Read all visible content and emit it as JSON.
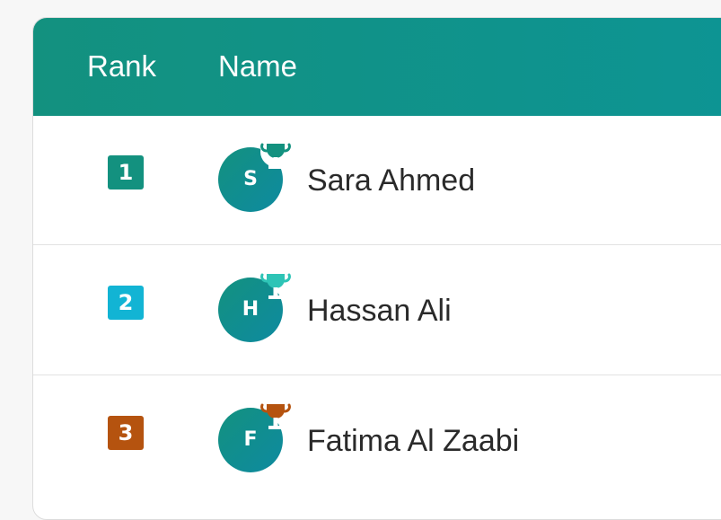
{
  "header": {
    "rank_label": "Rank",
    "name_label": "Name",
    "background": "#13917f"
  },
  "rows": [
    {
      "rank": "1",
      "rank_color": "#13917f",
      "initial": "S",
      "name": "Sara Ahmed",
      "trophy_icon": "trophy-icon",
      "trophy_color": "#ffffff"
    },
    {
      "rank": "2",
      "rank_color": "#12b4d4",
      "initial": "H",
      "name": "Hassan Ali",
      "trophy_icon": "trophy-icon",
      "trophy_color": "#2ec4b6"
    },
    {
      "rank": "3",
      "rank_color": "#b5530f",
      "initial": "F",
      "name": "Fatima Al Zaabi",
      "trophy_icon": "trophy-icon",
      "trophy_color": "#b5530f"
    }
  ]
}
